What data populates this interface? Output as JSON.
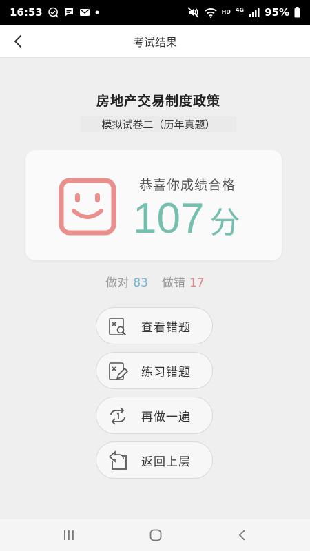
{
  "status_bar": {
    "time": "16:53",
    "battery": "95%",
    "hd": "HD",
    "network": "4G"
  },
  "nav": {
    "title": "考试结果",
    "back_icon": "chevron-left-icon"
  },
  "exam": {
    "title": "房地产交易制度政策",
    "subtitle": "模拟试卷二（历年真题）"
  },
  "score": {
    "congrats": "恭喜你成绩合格",
    "value": "107",
    "unit": "分",
    "face_icon": "smiley-face-icon"
  },
  "stats": {
    "right_label": "做对",
    "right_count": "83",
    "wrong_label": "做错",
    "wrong_count": "17"
  },
  "actions": [
    {
      "label": "查看错题",
      "icon": "review-mistakes-icon"
    },
    {
      "label": "练习错题",
      "icon": "practice-mistakes-icon"
    },
    {
      "label": "再做一遍",
      "icon": "redo-icon"
    },
    {
      "label": "返回上层",
      "icon": "return-icon"
    }
  ],
  "colors": {
    "score": "#74bfae",
    "smiley": "#e9908d",
    "right": "#73b6d2",
    "wrong": "#e08a8a"
  }
}
